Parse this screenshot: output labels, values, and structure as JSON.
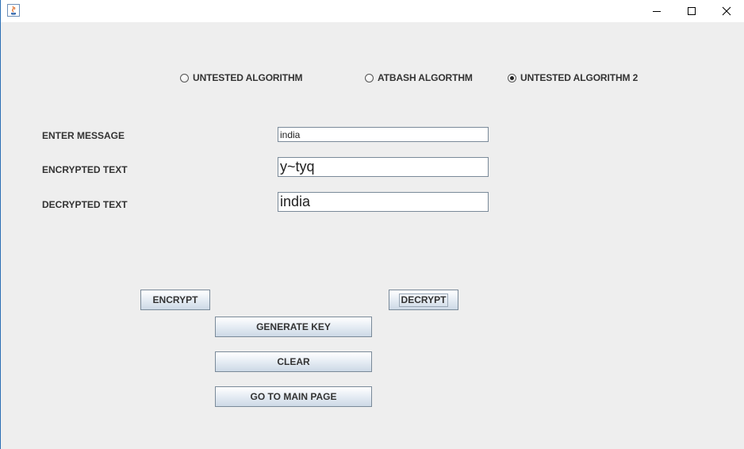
{
  "algorithms": [
    {
      "label": "UNTESTED ALGORITHM",
      "checked": false
    },
    {
      "label": "ATBASH ALGORTHM",
      "checked": false
    },
    {
      "label": "UNTESTED ALGORITHM 2",
      "checked": true
    }
  ],
  "form": {
    "message_label": "ENTER MESSAGE",
    "message_value": "india",
    "encrypted_label": "ENCRYPTED TEXT",
    "encrypted_value": "y~tyq",
    "decrypted_label": "DECRYPTED TEXT",
    "decrypted_value": "india"
  },
  "buttons": {
    "encrypt": "ENCRYPT",
    "decrypt": "DECRYPT",
    "generate_key": "GENERATE KEY",
    "clear": "CLEAR",
    "main_page": "GO TO MAIN PAGE"
  },
  "icons": {
    "app": "java-app-icon",
    "minimize": "minimize-icon",
    "maximize": "maximize-icon",
    "close": "close-icon"
  }
}
